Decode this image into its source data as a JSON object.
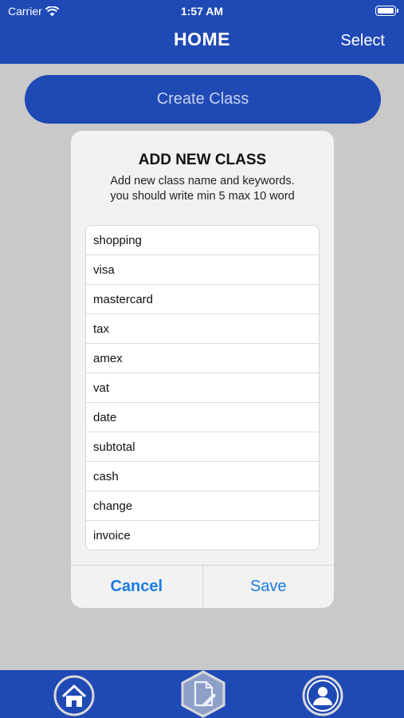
{
  "status_bar": {
    "carrier": "Carrier",
    "time": "1:57 AM"
  },
  "nav": {
    "title": "HOME",
    "select_label": "Select"
  },
  "create_button": {
    "label": "Create Class"
  },
  "modal": {
    "title": "ADD NEW CLASS",
    "message_line1": "Add new class name and keywords.",
    "message_line2": "you should write min 5 max 10 word",
    "keywords": [
      "shopping",
      "visa",
      "mastercard",
      "tax",
      "amex",
      "vat",
      "date",
      "subtotal",
      "cash",
      "change",
      "invoice"
    ],
    "cancel_label": "Cancel",
    "save_label": "Save"
  },
  "tabbar": {
    "tabs": [
      "home-icon",
      "document-edit-icon",
      "profile-icon"
    ]
  },
  "colors": {
    "brand": "#1f49b5",
    "action": "#1a7be0",
    "background": "#c9c9c9"
  }
}
